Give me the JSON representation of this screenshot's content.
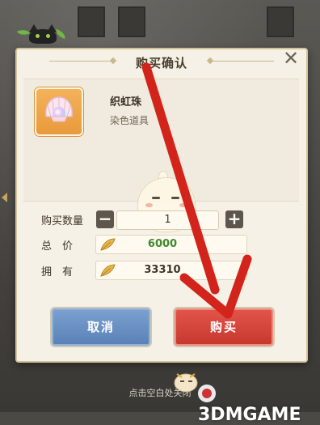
{
  "dialog": {
    "title": "购买确认",
    "close_icon": "close-icon"
  },
  "item": {
    "name": "织虹珠",
    "type": "染色道具",
    "icon": "pearl-shell-icon"
  },
  "purchase": {
    "quantity_label": "购买数量",
    "quantity": "1",
    "minus": "−",
    "plus": "+",
    "total_label": "总　价",
    "total_value": "6000",
    "owned_label": "拥　有",
    "owned_value": "33310",
    "currency_icon": "feather-coin-icon"
  },
  "buttons": {
    "cancel": "取消",
    "buy": "购买"
  },
  "footer": {
    "tip": "点击空白处关闭",
    "watermark": "3DMGAME"
  },
  "colors": {
    "total_value": "#3f8a2c",
    "owned_value": "#3e352a",
    "arrow": "#d3241b"
  }
}
